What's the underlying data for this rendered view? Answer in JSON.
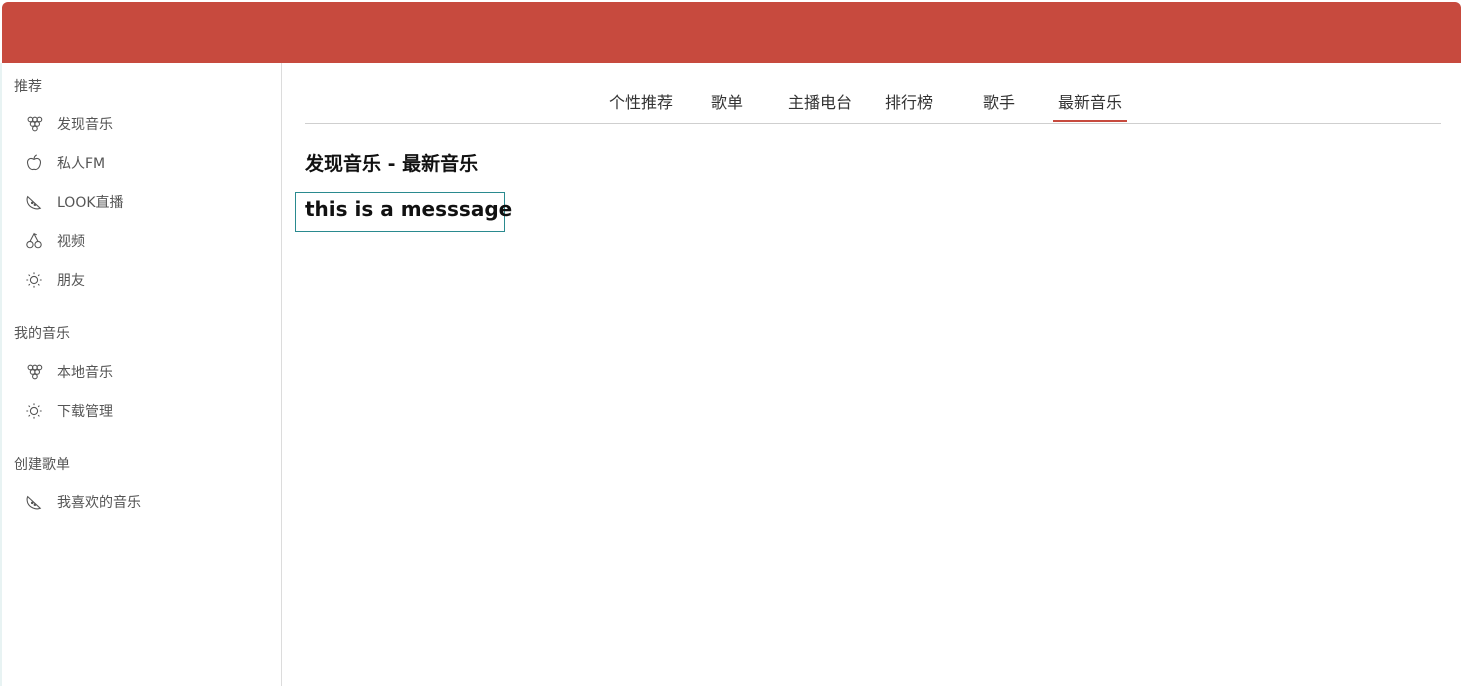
{
  "sidebar": {
    "sections": [
      {
        "title": "推荐",
        "items": [
          {
            "label": "发现音乐",
            "icon": "grapes-icon"
          },
          {
            "label": "私人FM",
            "icon": "apple-icon"
          },
          {
            "label": "LOOK直播",
            "icon": "watermelon-icon"
          },
          {
            "label": "视频",
            "icon": "cherry-icon"
          },
          {
            "label": "朋友",
            "icon": "sun-icon"
          }
        ]
      },
      {
        "title": "我的音乐",
        "items": [
          {
            "label": "本地音乐",
            "icon": "grapes-icon"
          },
          {
            "label": "下载管理",
            "icon": "sun-icon"
          }
        ]
      },
      {
        "title": "创建歌单",
        "items": [
          {
            "label": "我喜欢的音乐",
            "icon": "watermelon-icon"
          }
        ]
      }
    ]
  },
  "tabs": [
    {
      "label": "个性推荐",
      "active": false
    },
    {
      "label": "歌单",
      "active": false
    },
    {
      "label": "主播电台",
      "active": false
    },
    {
      "label": "排行榜",
      "active": false
    },
    {
      "label": "歌手",
      "active": false
    },
    {
      "label": "最新音乐",
      "active": true
    }
  ],
  "main": {
    "title": "发现音乐 - 最新音乐",
    "message": "this is a messsage"
  },
  "colors": {
    "header": "#c74a3e",
    "active_tab_underline": "#c74a3e",
    "message_border": "#2a8a8f"
  }
}
